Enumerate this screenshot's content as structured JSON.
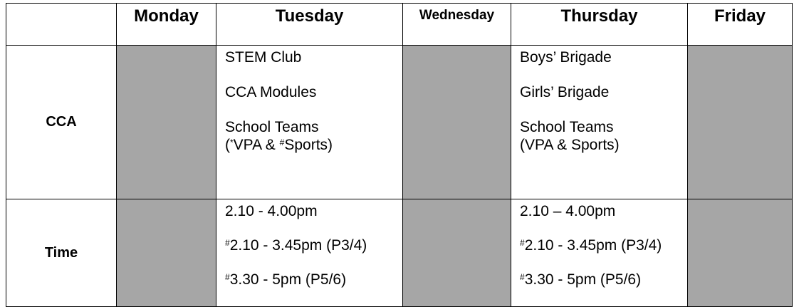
{
  "header": {
    "corner": "",
    "days": [
      "Monday",
      "Tuesday",
      "Wednesday",
      "Thursday",
      "Friday"
    ]
  },
  "rows": {
    "cca": {
      "label": "CCA",
      "tuesday": {
        "line1": "STEM Club",
        "line2": "CCA Modules",
        "line3": "School Teams",
        "line4_open": "(",
        "line4_sup1": "*",
        "line4_mid": "VPA & ",
        "line4_sup2": "#",
        "line4_end": "Sports)"
      },
      "thursday": {
        "line1": "Boys’ Brigade",
        "line2": "Girls’ Brigade",
        "line3": "School Teams",
        "line4": "(VPA & Sports)"
      }
    },
    "time": {
      "label": "Time",
      "tuesday": {
        "line1": "2.10 - 4.00pm",
        "line2_sup": "#",
        "line2": "2.10 - 3.45pm (P3/4)",
        "line3_sup": "#",
        "line3": "3.30 - 5pm (P5/6)"
      },
      "thursday": {
        "line1": "2.10 – 4.00pm",
        "line2_sup": "#",
        "line2": "2.10 - 3.45pm (P3/4)",
        "line3_sup": "#",
        "line3": "3.30 - 5pm (P5/6)"
      }
    }
  },
  "colors": {
    "empty_cell": "#a6a6a6",
    "border": "#000000"
  }
}
